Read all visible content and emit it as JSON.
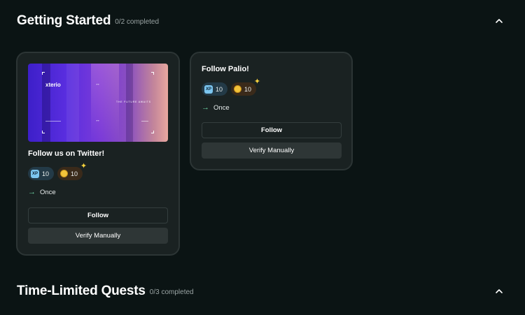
{
  "sections": [
    {
      "title": "Getting Started",
      "progress": "0/2 completed"
    },
    {
      "title": "Time-Limited Quests",
      "progress": "0/3 completed"
    }
  ],
  "cards": [
    {
      "title": "Follow us on Twitter!",
      "banner": {
        "brand": "xterio",
        "caption": "THE FUTURE AWAITS"
      },
      "rewards": {
        "xp_label": "XP",
        "xp": "10",
        "coin": "10"
      },
      "repeat": "Once",
      "primary_button": "Follow",
      "secondary_button": "Verify Manually"
    },
    {
      "title": "Follow Palio!",
      "rewards": {
        "xp_label": "XP",
        "xp": "10",
        "coin": "10"
      },
      "repeat": "Once",
      "primary_button": "Follow",
      "secondary_button": "Verify Manually"
    }
  ],
  "icons": {
    "collapse": "chevron-up-icon",
    "repeat": "arrow-right-icon",
    "coin": "coin-icon",
    "sparkle": "sparkle-icon"
  },
  "colors": {
    "background": "#0b1414",
    "card": "#1a2222",
    "accent_green": "#6fd9a8",
    "xp_blue": "#7cc6f0",
    "coin_gold": "#f3c33a"
  }
}
